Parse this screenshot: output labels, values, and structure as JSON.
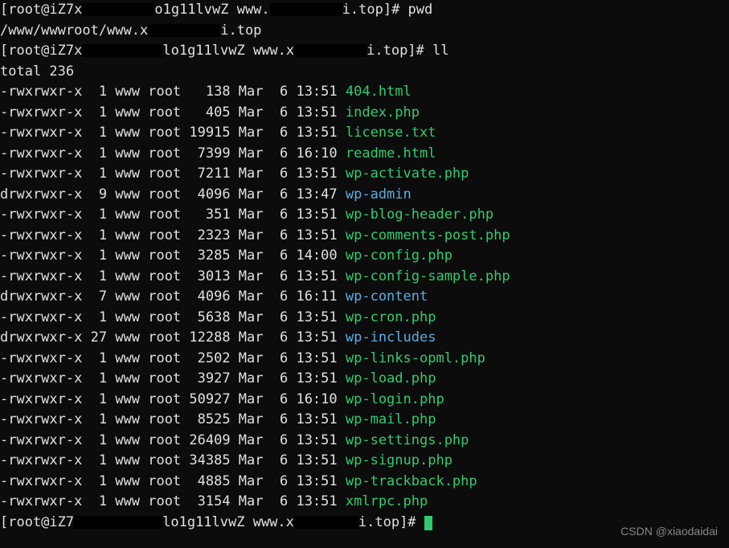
{
  "prompt1": {
    "prefix": "[root@iZ7x",
    "middle1": "o1g11lvwZ www.",
    "suffix": "i.top]# ",
    "cmd": "pwd"
  },
  "pwd_output": {
    "prefix": "/www/wwwroot/www.x",
    "suffix": "i.top"
  },
  "prompt2": {
    "prefix": "[root@iZ7x",
    "middle1": "lo1g11lvwZ www.x",
    "suffix": "i.top]# ",
    "cmd": "ll"
  },
  "total_line": "total 236",
  "listing": [
    {
      "perms": "-rwxrwxr-x",
      "links": "1",
      "owner": "www",
      "group": "root",
      "size": "138",
      "month": "Mar",
      "day": "6",
      "time": "13:51",
      "name": "404.html",
      "type": "file"
    },
    {
      "perms": "-rwxrwxr-x",
      "links": "1",
      "owner": "www",
      "group": "root",
      "size": "405",
      "month": "Mar",
      "day": "6",
      "time": "13:51",
      "name": "index.php",
      "type": "file"
    },
    {
      "perms": "-rwxrwxr-x",
      "links": "1",
      "owner": "www",
      "group": "root",
      "size": "19915",
      "month": "Mar",
      "day": "6",
      "time": "13:51",
      "name": "license.txt",
      "type": "file"
    },
    {
      "perms": "-rwxrwxr-x",
      "links": "1",
      "owner": "www",
      "group": "root",
      "size": "7399",
      "month": "Mar",
      "day": "6",
      "time": "16:10",
      "name": "readme.html",
      "type": "file"
    },
    {
      "perms": "-rwxrwxr-x",
      "links": "1",
      "owner": "www",
      "group": "root",
      "size": "7211",
      "month": "Mar",
      "day": "6",
      "time": "13:51",
      "name": "wp-activate.php",
      "type": "file"
    },
    {
      "perms": "drwxrwxr-x",
      "links": "9",
      "owner": "www",
      "group": "root",
      "size": "4096",
      "month": "Mar",
      "day": "6",
      "time": "13:47",
      "name": "wp-admin",
      "type": "dir"
    },
    {
      "perms": "-rwxrwxr-x",
      "links": "1",
      "owner": "www",
      "group": "root",
      "size": "351",
      "month": "Mar",
      "day": "6",
      "time": "13:51",
      "name": "wp-blog-header.php",
      "type": "file"
    },
    {
      "perms": "-rwxrwxr-x",
      "links": "1",
      "owner": "www",
      "group": "root",
      "size": "2323",
      "month": "Mar",
      "day": "6",
      "time": "13:51",
      "name": "wp-comments-post.php",
      "type": "file"
    },
    {
      "perms": "-rwxrwxr-x",
      "links": "1",
      "owner": "www",
      "group": "root",
      "size": "3285",
      "month": "Mar",
      "day": "6",
      "time": "14:00",
      "name": "wp-config.php",
      "type": "file"
    },
    {
      "perms": "-rwxrwxr-x",
      "links": "1",
      "owner": "www",
      "group": "root",
      "size": "3013",
      "month": "Mar",
      "day": "6",
      "time": "13:51",
      "name": "wp-config-sample.php",
      "type": "file"
    },
    {
      "perms": "drwxrwxr-x",
      "links": "7",
      "owner": "www",
      "group": "root",
      "size": "4096",
      "month": "Mar",
      "day": "6",
      "time": "16:11",
      "name": "wp-content",
      "type": "dir"
    },
    {
      "perms": "-rwxrwxr-x",
      "links": "1",
      "owner": "www",
      "group": "root",
      "size": "5638",
      "month": "Mar",
      "day": "6",
      "time": "13:51",
      "name": "wp-cron.php",
      "type": "file"
    },
    {
      "perms": "drwxrwxr-x",
      "links": "27",
      "owner": "www",
      "group": "root",
      "size": "12288",
      "month": "Mar",
      "day": "6",
      "time": "13:51",
      "name": "wp-includes",
      "type": "dir"
    },
    {
      "perms": "-rwxrwxr-x",
      "links": "1",
      "owner": "www",
      "group": "root",
      "size": "2502",
      "month": "Mar",
      "day": "6",
      "time": "13:51",
      "name": "wp-links-opml.php",
      "type": "file"
    },
    {
      "perms": "-rwxrwxr-x",
      "links": "1",
      "owner": "www",
      "group": "root",
      "size": "3927",
      "month": "Mar",
      "day": "6",
      "time": "13:51",
      "name": "wp-load.php",
      "type": "file"
    },
    {
      "perms": "-rwxrwxr-x",
      "links": "1",
      "owner": "www",
      "group": "root",
      "size": "50927",
      "month": "Mar",
      "day": "6",
      "time": "16:10",
      "name": "wp-login.php",
      "type": "file"
    },
    {
      "perms": "-rwxrwxr-x",
      "links": "1",
      "owner": "www",
      "group": "root",
      "size": "8525",
      "month": "Mar",
      "day": "6",
      "time": "13:51",
      "name": "wp-mail.php",
      "type": "file"
    },
    {
      "perms": "-rwxrwxr-x",
      "links": "1",
      "owner": "www",
      "group": "root",
      "size": "26409",
      "month": "Mar",
      "day": "6",
      "time": "13:51",
      "name": "wp-settings.php",
      "type": "file"
    },
    {
      "perms": "-rwxrwxr-x",
      "links": "1",
      "owner": "www",
      "group": "root",
      "size": "34385",
      "month": "Mar",
      "day": "6",
      "time": "13:51",
      "name": "wp-signup.php",
      "type": "file"
    },
    {
      "perms": "-rwxrwxr-x",
      "links": "1",
      "owner": "www",
      "group": "root",
      "size": "4885",
      "month": "Mar",
      "day": "6",
      "time": "13:51",
      "name": "wp-trackback.php",
      "type": "file"
    },
    {
      "perms": "-rwxrwxr-x",
      "links": "1",
      "owner": "www",
      "group": "root",
      "size": "3154",
      "month": "Mar",
      "day": "6",
      "time": "13:51",
      "name": "xmlrpc.php",
      "type": "file"
    }
  ],
  "prompt3": {
    "prefix": "[root@iZ7",
    "middle1": "lo1g11lvwZ www.x",
    "suffix": "i.top]# "
  },
  "watermark": "CSDN @xiaodaidai"
}
